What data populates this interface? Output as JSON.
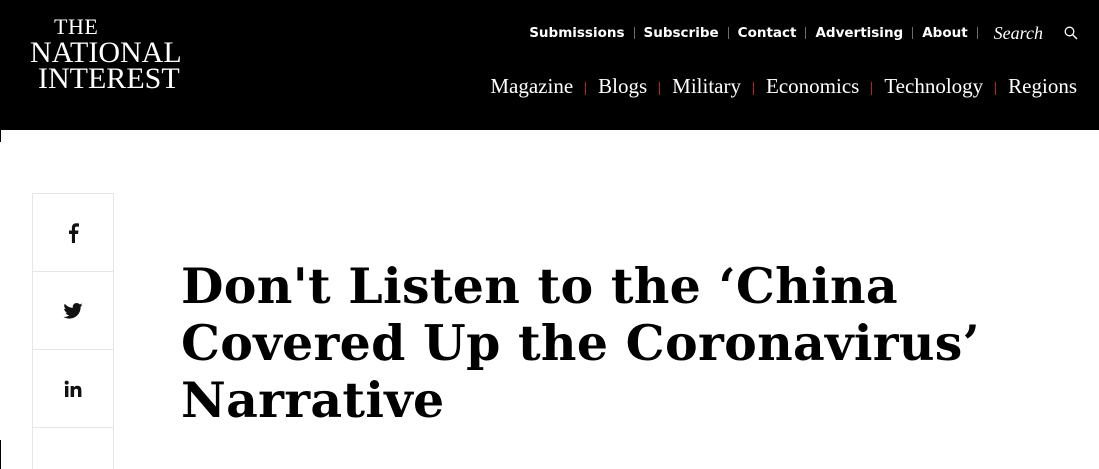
{
  "header": {
    "logo": {
      "line1": "THE",
      "line2": "NATIONAL",
      "line3": "INTEREST"
    },
    "top_nav": [
      "Submissions",
      "Subscribe",
      "Contact",
      "Advertising",
      "About"
    ],
    "search": {
      "label": "Search",
      "icon": "search-icon"
    },
    "main_nav": [
      "Magazine",
      "Blogs",
      "Military",
      "Economics",
      "Technology",
      "Regions"
    ]
  },
  "share": {
    "buttons": [
      {
        "icon": "facebook-icon",
        "glyph": "f"
      },
      {
        "icon": "twitter-icon"
      },
      {
        "icon": "linkedin-icon",
        "glyph": "in"
      }
    ]
  },
  "article": {
    "title_lines": [
      "Don't Listen to the ‘China",
      "Covered Up the Coronavirus’",
      "Narrative"
    ]
  },
  "colors": {
    "header_bg": "#000000",
    "nav_separator_accent": "#c2183a",
    "text": "#000000",
    "border": "#e6e6e6"
  }
}
